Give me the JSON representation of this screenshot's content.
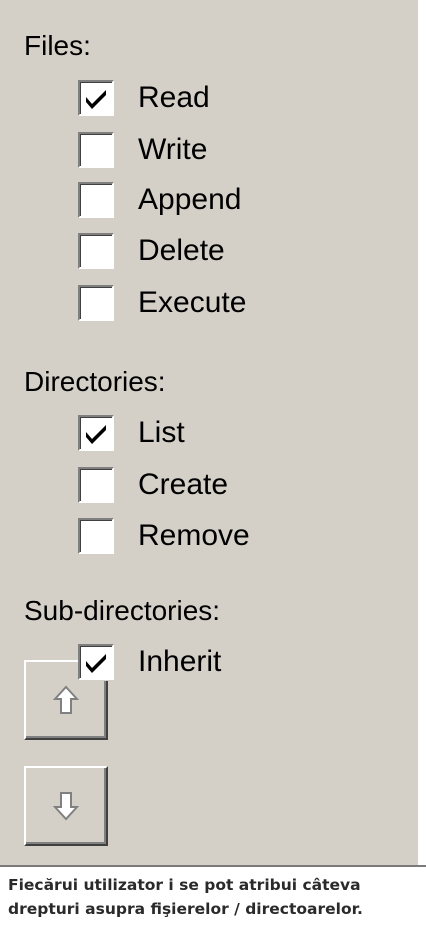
{
  "sections": {
    "files": {
      "heading": "Files:",
      "items": [
        {
          "label": "Read",
          "checked": true
        },
        {
          "label": "Write",
          "checked": false
        },
        {
          "label": "Append",
          "checked": false
        },
        {
          "label": "Delete",
          "checked": false
        },
        {
          "label": "Execute",
          "checked": false
        }
      ]
    },
    "directories": {
      "heading": "Directories:",
      "items": [
        {
          "label": "List",
          "checked": true
        },
        {
          "label": "Create",
          "checked": false
        },
        {
          "label": "Remove",
          "checked": false
        }
      ]
    },
    "subdirectories": {
      "heading": "Sub-directories:",
      "items": [
        {
          "label": "Inherit",
          "checked": true
        }
      ]
    }
  },
  "buttons": {
    "move_up_icon": "up-arrow-icon",
    "move_down_icon": "down-arrow-icon"
  },
  "caption": "Fiecărui utilizator i se pot atribui câteva drepturi asupra fişierelor / directoarelor.",
  "colors": {
    "panel_background": "#d4d0c8",
    "checkbox_background": "#ffffff",
    "caption_text": "#2a2a2a"
  }
}
